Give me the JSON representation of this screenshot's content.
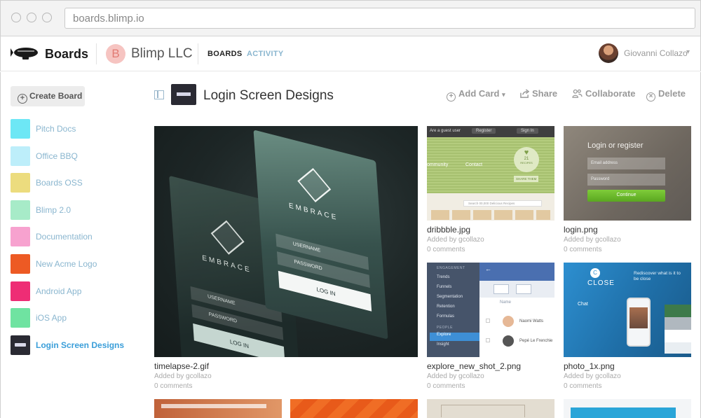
{
  "browser": {
    "url": "boards.blimp.io"
  },
  "header": {
    "brand": "Boards",
    "org_initial": "B",
    "org_name": "Blimp LLC",
    "nav": {
      "boards": "BOARDS",
      "activity": "ACTIVITY"
    },
    "user_name": "Giovanni Collazo",
    "user_caret": "▾"
  },
  "sidebar": {
    "create_label": "Create Board",
    "items": [
      {
        "label": "Pitch Docs",
        "color": "#6de7f5"
      },
      {
        "label": "Office BBQ",
        "color": "#bdeefa"
      },
      {
        "label": "Boards OSS",
        "color": "#ecdc7e"
      },
      {
        "label": "Blimp 2.0",
        "color": "#a7ebc8"
      },
      {
        "label": "Documentation",
        "color": "#f7a2cf"
      },
      {
        "label": "New Acme Logo",
        "color": "#ed5a24"
      },
      {
        "label": "Android App",
        "color": "#ee2d75"
      },
      {
        "label": "iOS App",
        "color": "#6fe3a1"
      },
      {
        "label": "Login Screen Designs",
        "color": "#2a2a33",
        "active": true
      }
    ]
  },
  "board": {
    "title": "Login Screen Designs",
    "actions": {
      "add_card": "Add Card",
      "share": "Share",
      "collaborate": "Collaborate",
      "delete": "Delete"
    },
    "add_caret": "▾"
  },
  "cards": [
    {
      "name": "timelapse-2.gif",
      "added": "Added by gcollazo",
      "comments": "0 comments",
      "embrace": "EMBRACE",
      "username": "USERNAME",
      "password": "PASSWORD",
      "login": "LOG IN"
    },
    {
      "name": "dribbble.jpg",
      "added": "Added by gcollazo",
      "comments": "0 comments",
      "guest": "Are a guest user",
      "register": "Register",
      "signin": "Sign In",
      "community": "ommunity",
      "contact": "Contact",
      "count": "21",
      "recipes": "RECIPES",
      "share": "SHARE THEM",
      "search": "Search 00,000 Delicious Recipes"
    },
    {
      "name": "login.png",
      "added": "Added by gcollazo",
      "comments": "0 comments",
      "heading": "Login or register",
      "email": "Email address",
      "password": "Password",
      "continue": "Continue"
    },
    {
      "name": "explore_new_shot_2.png",
      "added": "Added by gcollazo",
      "comments": "0 comments",
      "engagement": "ENGAGEMENT",
      "menu": [
        "Trends",
        "Funnels",
        "Segmentation",
        "Retention",
        "Formulas"
      ],
      "people": "PEOPLE",
      "menu2": [
        "Explore",
        "Insight"
      ],
      "col_name": "Name",
      "person1": "Naomi Watts",
      "person2": "Pepé Le Frenchie"
    },
    {
      "name": "photo_1x.png",
      "added": "Added by gcollazo",
      "comments": "0 comments",
      "close": "CLOSE",
      "tagline": "Rediscover what is it to be close",
      "chat": "Chat"
    }
  ]
}
